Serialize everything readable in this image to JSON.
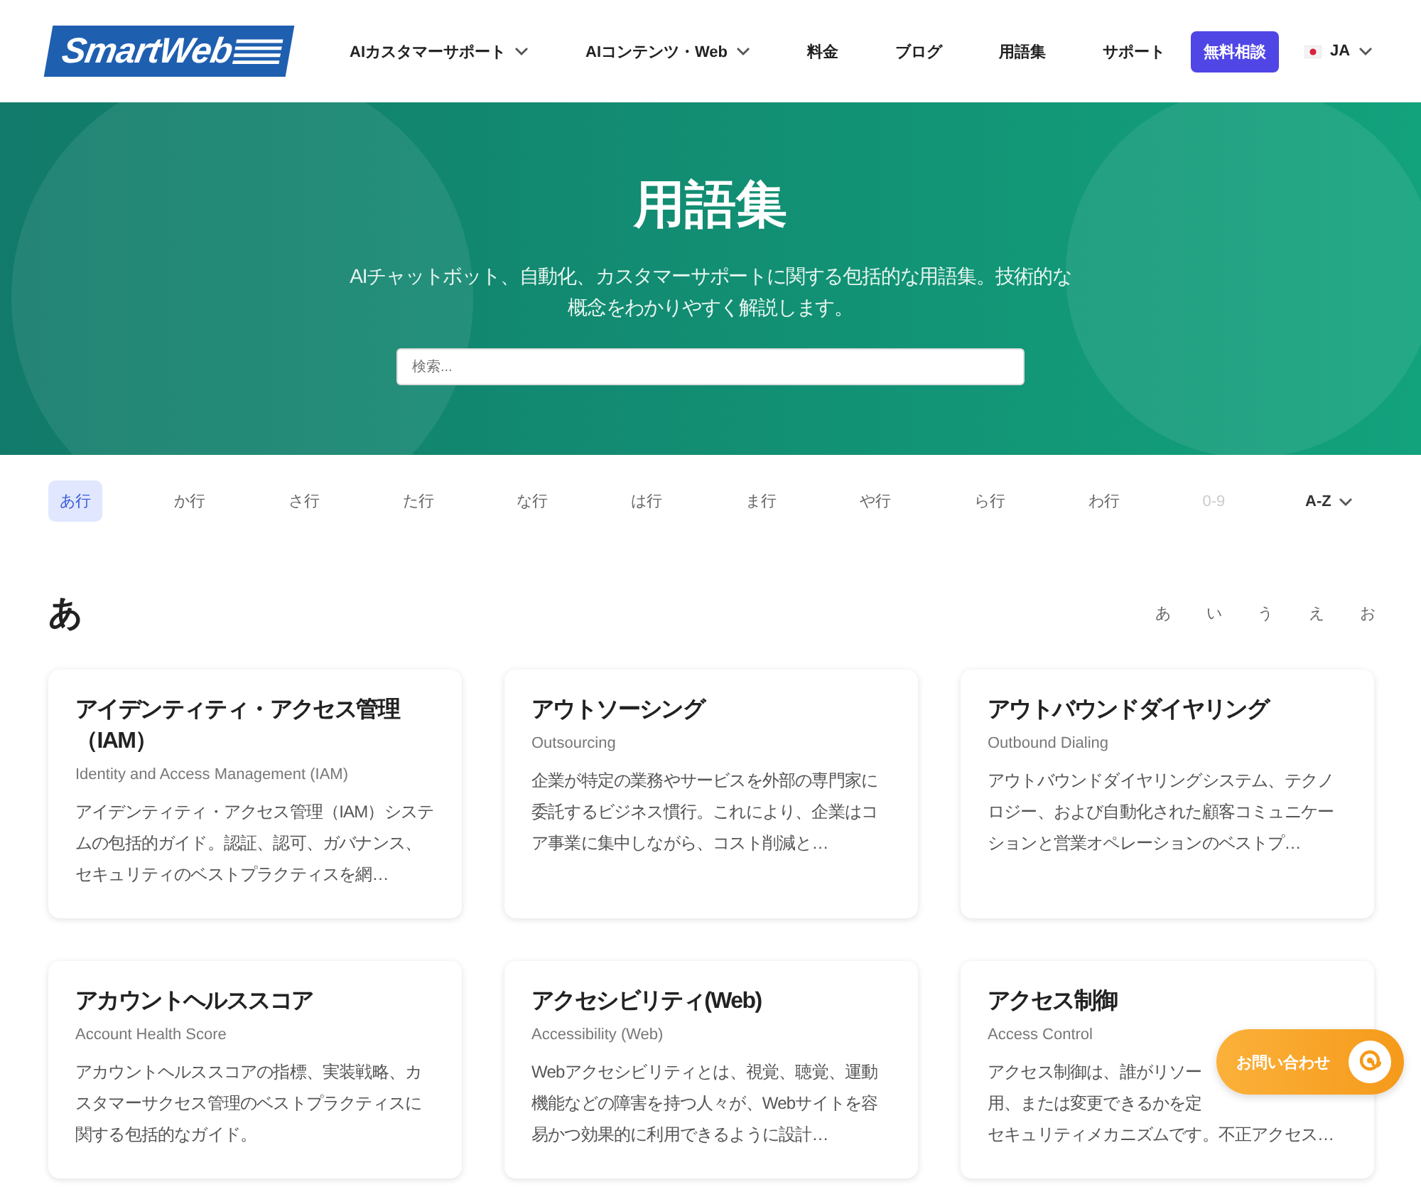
{
  "header": {
    "logo": "SmartWeb",
    "nav": [
      {
        "label": "AIカスタマーサポート",
        "dropdown": true
      },
      {
        "label": "AIコンテンツ・Web",
        "dropdown": true
      },
      {
        "label": "料金",
        "dropdown": false
      },
      {
        "label": "ブログ",
        "dropdown": false
      },
      {
        "label": "用語集",
        "dropdown": false
      },
      {
        "label": "サポート",
        "dropdown": false
      }
    ],
    "cta": "無料相談",
    "language": "JA"
  },
  "hero": {
    "title": "用語集",
    "subtitle": "AIチャットボット、自動化、カスタマーサポートに関する包括的な用語集。技術的な概念をわかりやすく解説します。",
    "search": {
      "placeholder": "検索..."
    }
  },
  "filter_tabs": [
    {
      "label": "あ行",
      "selected": true,
      "disabled": false
    },
    {
      "label": "か行",
      "selected": false,
      "disabled": false
    },
    {
      "label": "さ行",
      "selected": false,
      "disabled": false
    },
    {
      "label": "た行",
      "selected": false,
      "disabled": false
    },
    {
      "label": "な行",
      "selected": false,
      "disabled": false
    },
    {
      "label": "は行",
      "selected": false,
      "disabled": false
    },
    {
      "label": "ま行",
      "selected": false,
      "disabled": false
    },
    {
      "label": "や行",
      "selected": false,
      "disabled": false
    },
    {
      "label": "ら行",
      "selected": false,
      "disabled": false
    },
    {
      "label": "わ行",
      "selected": false,
      "disabled": false
    },
    {
      "label": "0-9",
      "selected": false,
      "disabled": true
    }
  ],
  "alphabet_toggle": "A-Z",
  "section": {
    "heading": "あ",
    "jump_links": [
      "あ",
      "い",
      "う",
      "え",
      "お"
    ],
    "cards": [
      {
        "title": "アイデンティティ・アクセス管理（IAM）",
        "subtitle": "Identity and Access Management (IAM)",
        "description": "アイデンティティ・アクセス管理（IAM）システムの包括的ガイド。認証、認可、ガバナンス、セキュリティのベストプラクティスを網…"
      },
      {
        "title": "アウトソーシング",
        "subtitle": "Outsourcing",
        "description": "企業が特定の業務やサービスを外部の専門家に委託するビジネス慣行。これにより、企業はコア事業に集中しながら、コスト削減と…"
      },
      {
        "title": "アウトバウンドダイヤリング",
        "subtitle": "Outbound Dialing",
        "description": "アウトバウンドダイヤリングシステム、テクノロジー、および自動化された顧客コミュニケーションと営業オペレーションのベストプ…"
      },
      {
        "title": "アカウントヘルススコア",
        "subtitle": "Account Health Score",
        "description": "アカウントヘルススコアの指標、実装戦略、カスタマーサクセス管理のベストプラクティスに関する包括的なガイド。"
      },
      {
        "title": "アクセシビリティ(Web)",
        "subtitle": "Accessibility (Web)",
        "description": "Webアクセシビリティとは、視覚、聴覚、運動機能などの障害を持つ人々が、Webサイトを容易かつ効果的に利用できるように設計…"
      },
      {
        "title": "アクセス制御",
        "subtitle": "Access Control",
        "description_lines": [
          "アクセス制御は、誰がリソー",
          "用、または変更できるかを定",
          "セキュリティメカニズムです。不正アクセス…"
        ]
      }
    ]
  },
  "contact_button": "お問い合わせ"
}
